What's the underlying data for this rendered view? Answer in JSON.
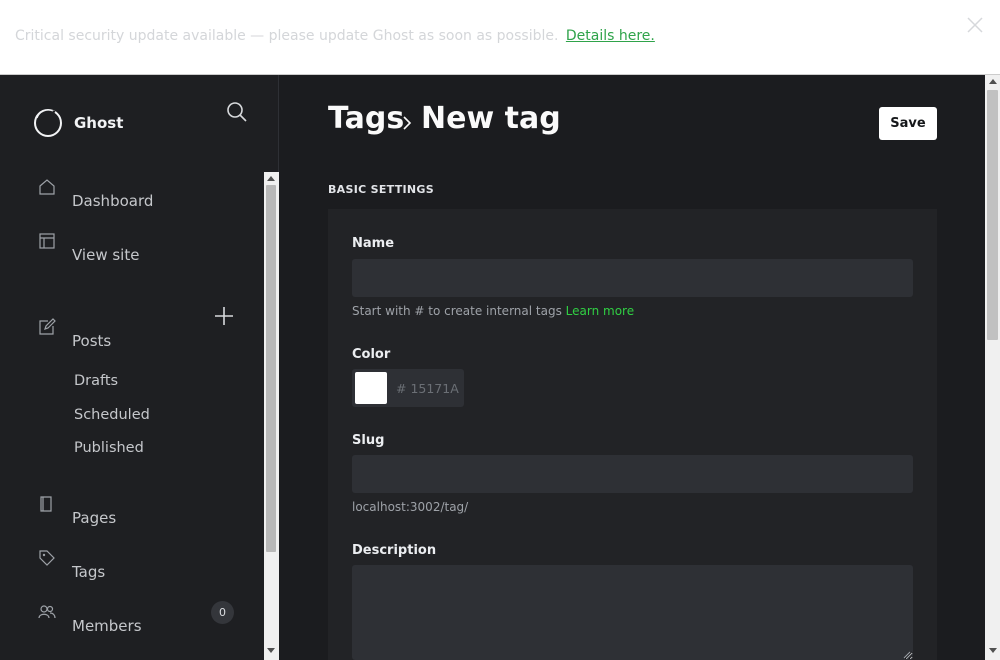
{
  "alert": {
    "message": "Critical security update available — please update Ghost as soon as possible.",
    "link_text": "Details here."
  },
  "sidebar": {
    "brand": "Ghost",
    "nav": {
      "dashboard": "Dashboard",
      "view_site": "View site",
      "posts": "Posts",
      "pages": "Pages",
      "tags": "Tags",
      "members": "Members"
    },
    "posts_sub": {
      "drafts": "Drafts",
      "scheduled": "Scheduled",
      "published": "Published"
    },
    "members_count": "0"
  },
  "header": {
    "breadcrumb_parent": "Tags",
    "breadcrumb_current": "New tag",
    "save_label": "Save"
  },
  "form": {
    "section_title": "BASIC SETTINGS",
    "name_label": "Name",
    "name_value": "",
    "name_hint": "Start with # to create internal tags",
    "name_hint_link": "Learn more",
    "color_label": "Color",
    "color_placeholder": "# 15171A",
    "color_value": "#ffffff",
    "slug_label": "Slug",
    "slug_value": "",
    "slug_hint": "localhost:3002/tag/",
    "description_label": "Description",
    "description_value": ""
  },
  "colors": {
    "accent_green": "#30cf43",
    "sidebar_bg": "#1e1f22",
    "main_bg": "#1b1c1f",
    "input_bg": "#2e3035"
  }
}
